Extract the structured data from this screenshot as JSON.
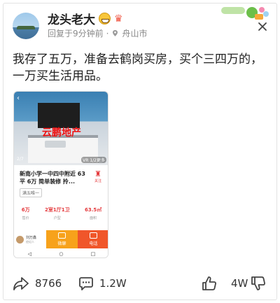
{
  "post": {
    "author": "龙头老大",
    "time_location": "回复于9分钟前",
    "separator": "·",
    "location": "舟山市",
    "text": "我存了五万，准备去鹤岗买房，买个三四万的，一万买生活用品。"
  },
  "screenshot": {
    "watermark": "云鹏地产",
    "page_indicator": "2/7",
    "view_indicator": "VR 1/2更多",
    "listing_title": "新南小学一中四中附近 63平 6万 简单装修 拎...",
    "fav_label": "关注",
    "tag": "满五唯一",
    "stats": [
      {
        "value": "6万",
        "label": "售价"
      },
      {
        "value": "2室1厅1卫",
        "label": "户型"
      },
      {
        "value": "63.5㎡",
        "label": "面积"
      }
    ],
    "agent_name": "刘万鑫",
    "agent_sub": "经纪人",
    "chat_label": "微聊",
    "call_label": "电话",
    "nav": [
      "◁",
      "○",
      "□"
    ]
  },
  "actions": {
    "share_count": "8766",
    "comment_count": "1.2W",
    "like_count": "4W"
  },
  "icons": [
    "close-icon",
    "location-pin-icon",
    "share-icon",
    "comment-icon",
    "thumbs-up-icon",
    "thumbs-down-icon"
  ]
}
